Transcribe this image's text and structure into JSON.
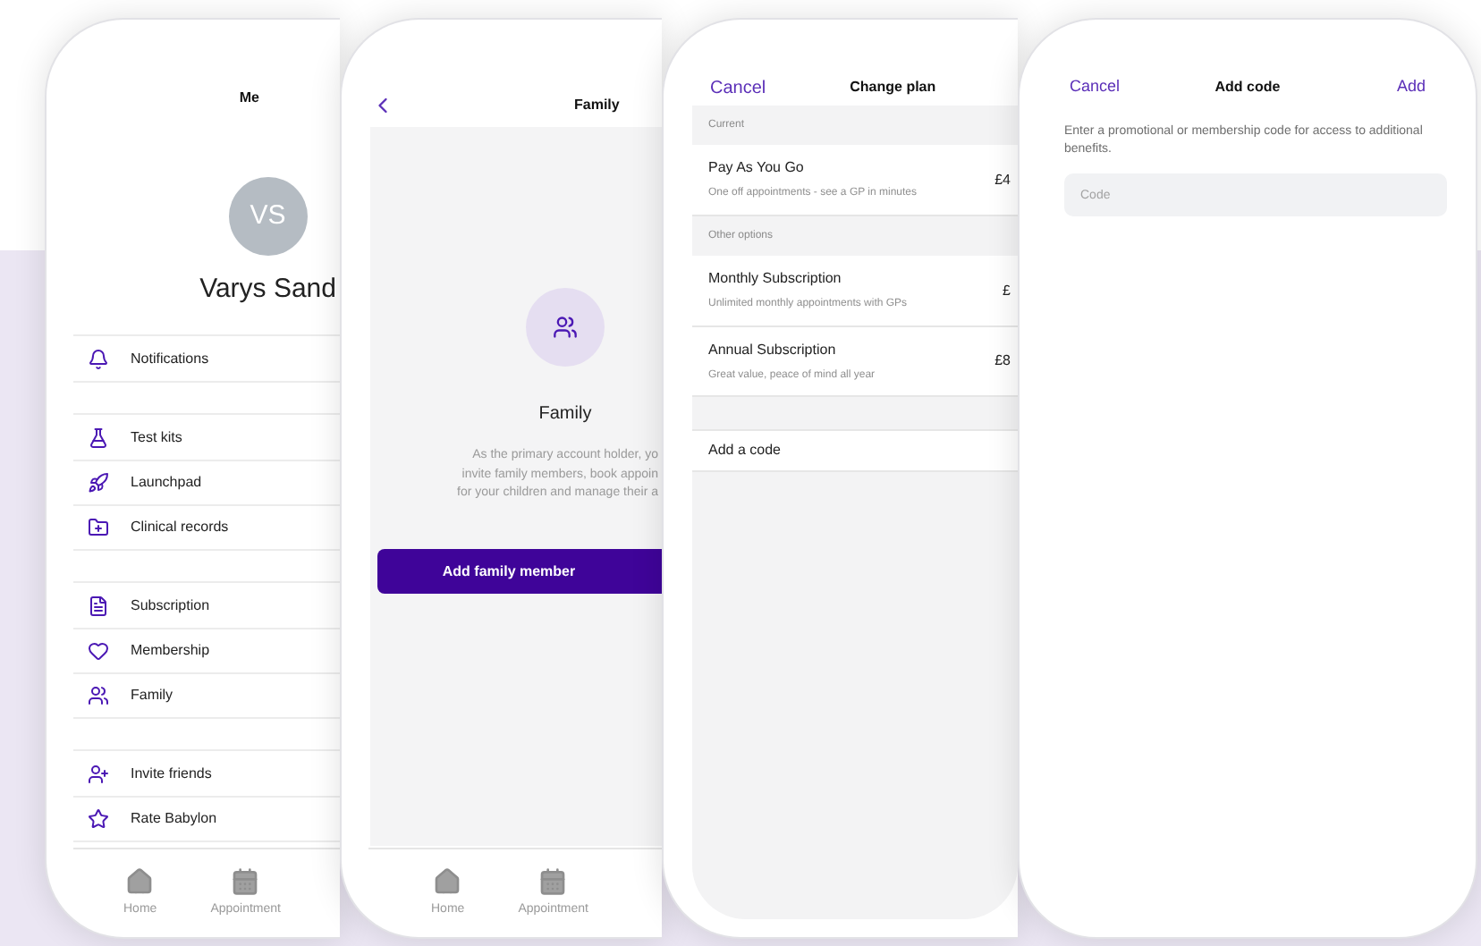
{
  "screens": [
    {
      "kind": "profile",
      "title": "Me",
      "avatar": "VS",
      "name": "Varys Sand",
      "groups": [
        [
          "Notifications"
        ],
        [
          "Test kits",
          "Launchpad",
          "Clinical records"
        ],
        [
          "Subscription",
          "Membership",
          "Family"
        ],
        [
          "Invite friends",
          "Rate Babylon"
        ]
      ],
      "tabs": [
        "Home",
        "Appointment"
      ]
    },
    {
      "kind": "family",
      "title": "Family",
      "heading": "Family",
      "body_lines": [
        "As the primary account holder, yo",
        "invite family members, book appoin",
        "for your children and manage their a"
      ],
      "button": "Add family member",
      "tabs": [
        "Home",
        "Appointment"
      ]
    },
    {
      "kind": "plan",
      "cancel": "Cancel",
      "title": "Change plan",
      "sections": [
        {
          "header": "Current",
          "plans": [
            {
              "name": "Pay As You Go",
              "description": "One off appointments - see a GP in minutes",
              "price": "£4"
            }
          ]
        },
        {
          "header": "Other options",
          "plans": [
            {
              "name": "Monthly Subscription",
              "description": "Unlimited monthly appointments with GPs",
              "price": "£"
            },
            {
              "name": "Annual Subscription",
              "description": "Great value, peace of mind all year",
              "price": "£8"
            }
          ]
        }
      ],
      "code_row": "Add a code"
    },
    {
      "kind": "code",
      "cancel": "Cancel",
      "title": "Add code",
      "action": "Add",
      "description": "Enter a promotional or membership code for access to additional benefits.",
      "placeholder": "Code"
    }
  ]
}
